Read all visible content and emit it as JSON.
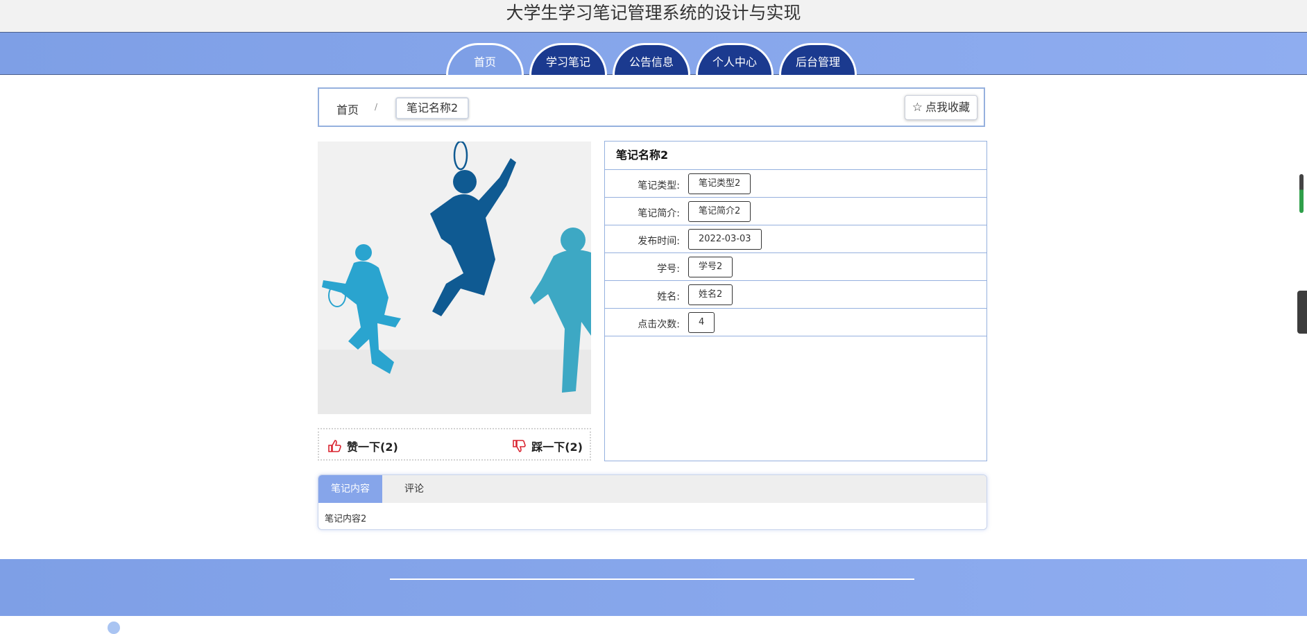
{
  "site": {
    "title": "大学生学习笔记管理系统的设计与实现"
  },
  "nav": {
    "items": [
      {
        "label": "首页",
        "active": true
      },
      {
        "label": "学习笔记",
        "active": false
      },
      {
        "label": "公告信息",
        "active": false
      },
      {
        "label": "个人中心",
        "active": false
      },
      {
        "label": "后台管理",
        "active": false
      }
    ]
  },
  "breadcrumb": {
    "home": "首页",
    "separator": "/",
    "current": "笔记名称2"
  },
  "favorite": {
    "label": "点我收藏",
    "icon": "star-outline-icon"
  },
  "votes": {
    "like_label": "赞一下(2)",
    "dislike_label": "踩一下(2)",
    "like_icon": "thumbs-up-icon",
    "dislike_icon": "thumbs-down-icon",
    "icon_color": "#d9232f"
  },
  "detail": {
    "title": "笔记名称2",
    "fields": [
      {
        "label": "笔记类型:",
        "value": "笔记类型2"
      },
      {
        "label": "笔记简介:",
        "value": "笔记简介2"
      },
      {
        "label": "发布时间:",
        "value": "2022-03-03"
      },
      {
        "label": "学号:",
        "value": "学号2"
      },
      {
        "label": "姓名:",
        "value": "姓名2"
      },
      {
        "label": "点击次数:",
        "value": "4"
      }
    ]
  },
  "tabs": {
    "items": [
      {
        "label": "笔记内容",
        "active": true
      },
      {
        "label": "评论",
        "active": false
      }
    ],
    "content": "笔记内容2"
  },
  "colors": {
    "nav_bg": "#7e9fe6",
    "nav_item": "#1b3a8f",
    "border": "#95b0de"
  }
}
